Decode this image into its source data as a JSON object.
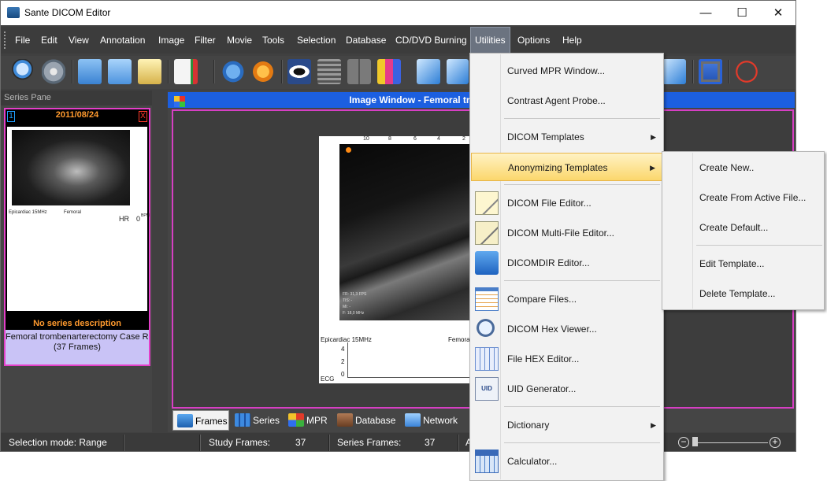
{
  "window": {
    "title": "Sante DICOM Editor",
    "minimize": "—",
    "maximize": "☐",
    "close": "✕"
  },
  "menubar": {
    "items": [
      "File",
      "Edit",
      "View",
      "Annotation",
      "Image",
      "Filter",
      "Movie",
      "Tools",
      "Selection",
      "Database",
      "CD/DVD Burning",
      "Utilities",
      "Options",
      "Help"
    ],
    "active": "Utilities"
  },
  "series_pane": {
    "header": "Series Pane",
    "thumbnail": {
      "index": "1",
      "date": "2011/08/24",
      "close": "X",
      "image_left_label": "Epicardiac 15MHz",
      "image_mid_label": "Femoral",
      "image_hr_label": "HR",
      "image_bpm_label": "0",
      "image_bpm_unit": "BPM",
      "description": "No series description",
      "caption_line1": "Femoral trombenarterectomy Case Report",
      "caption_line2": "(37 Frames)"
    }
  },
  "image_window": {
    "title": "Image Window - Femoral trombenarterectomy Case Report",
    "image": {
      "ticks": [
        "10",
        "8",
        "6",
        "4",
        "2"
      ],
      "left_label": "Epicardiac 15MHz",
      "mid_label": "Femora",
      "ecg_label": "ECG",
      "info_fr": "FR: 31,3 FPS",
      "info_ti": "TIS: -",
      "info_mi": "MI: -",
      "info_f": "F: 18,0 MHz",
      "ecg_scale": [
        "4",
        "2",
        "0"
      ]
    }
  },
  "bottom_tabs": [
    "Frames",
    "Series",
    "MPR",
    "Database",
    "Network"
  ],
  "statusbar": {
    "mode": "Selection mode: Range",
    "study_frames_label": "Study Frames:",
    "study_frames_value": "37",
    "series_frames_label": "Series Frames:",
    "series_frames_value": "37",
    "truncated": "A"
  },
  "utilities_menu": {
    "items": [
      {
        "label": "Curved MPR Window...",
        "icon": "none",
        "arrow": ""
      },
      {
        "label": "Contrast Agent Probe...",
        "icon": "none",
        "arrow": ""
      },
      {
        "label": "DICOM Templates",
        "icon": "none",
        "arrow": "▶"
      },
      {
        "label": "Anonymizing Templates",
        "icon": "none",
        "arrow": "▶"
      },
      {
        "label": "DICOM File Editor...",
        "icon": "file-editor-icon",
        "arrow": ""
      },
      {
        "label": "DICOM Multi-File Editor...",
        "icon": "multi-file-editor-icon",
        "arrow": ""
      },
      {
        "label": "DICOMDIR Editor...",
        "icon": "dicomdir-editor-icon",
        "arrow": ""
      },
      {
        "label": "Compare Files...",
        "icon": "compare-files-icon",
        "arrow": ""
      },
      {
        "label": "DICOM Hex Viewer...",
        "icon": "hex-viewer-icon",
        "arrow": ""
      },
      {
        "label": "File HEX Editor...",
        "icon": "hex-editor-icon",
        "arrow": ""
      },
      {
        "label": "UID Generator...",
        "icon": "uid-generator-icon",
        "arrow": ""
      },
      {
        "label": "Dictionary",
        "icon": "none",
        "arrow": "▶"
      },
      {
        "label": "Calculator...",
        "icon": "calculator-icon",
        "arrow": ""
      }
    ],
    "highlighted": "Anonymizing Templates"
  },
  "anonymizing_submenu": {
    "items": [
      "Create New..",
      "Create From Active File...",
      "Create Default...",
      "Edit Template...",
      "Delete Template..."
    ]
  },
  "colors": {
    "highlight": "#fbd76c",
    "title_blue": "#1c5fe0",
    "selection_magenta": "#d63fc3",
    "accent_orange": "#ff9a2e"
  }
}
